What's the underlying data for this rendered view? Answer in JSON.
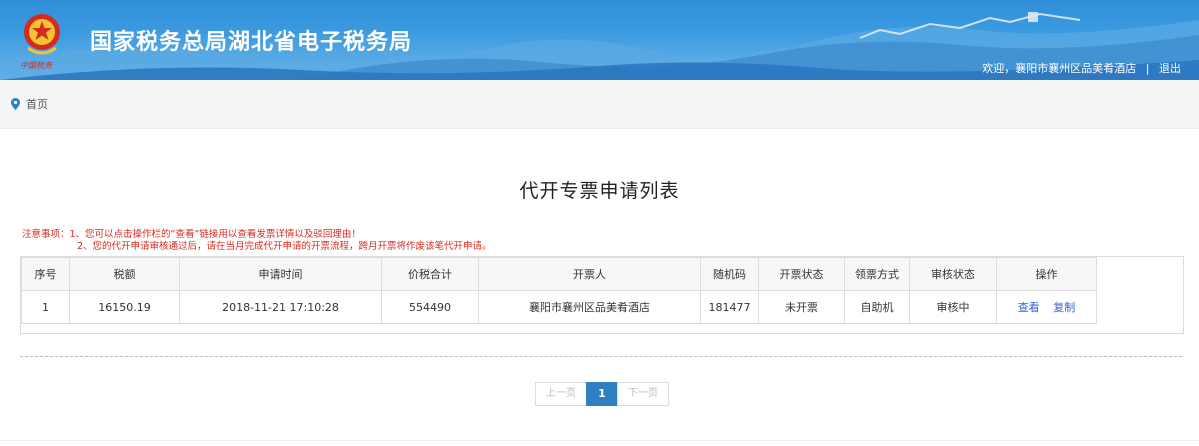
{
  "header": {
    "title": "国家税务总局湖北省电子税务局",
    "emblem_caption": "中国税务",
    "welcome": "欢迎，襄阳市襄州区品美肴酒店",
    "logout_label": "退出",
    "separator": "|"
  },
  "breadcrumb": {
    "home_label": "首页"
  },
  "page": {
    "title": "代开专票申请列表"
  },
  "notice": {
    "line1": "注意事项：1、您可以点击操作栏的“查看”链接用以查看发票详情以及驳回理由！",
    "line2": "2、您的代开申请审核通过后，请在当月完成代开申请的开票流程，跨月开票将作废该笔代开申请。"
  },
  "table": {
    "headers": [
      "序号",
      "税额",
      "申请时间",
      "价税合计",
      "开票人",
      "随机码",
      "开票状态",
      "领票方式",
      "审核状态",
      "操作"
    ],
    "rows": [
      {
        "index": "1",
        "tax": "16150.19",
        "time": "2018-11-21 17:10:28",
        "total": "554490",
        "issuer": "襄阳市襄州区品美肴酒店",
        "random_code": "181477",
        "invoice_status": "未开票",
        "pickup_method": "自助机",
        "review_status": "审核中",
        "action_view": "查看",
        "action_copy": "复制"
      }
    ]
  },
  "pagination": {
    "prev_label": "上一页",
    "current_page": "1",
    "next_label": "下一页"
  },
  "colors": {
    "header_blue": "#3b9ae0",
    "notice_red": "#d62b20",
    "link_blue": "#3366cc",
    "pager_active": "#2e7fc4"
  }
}
